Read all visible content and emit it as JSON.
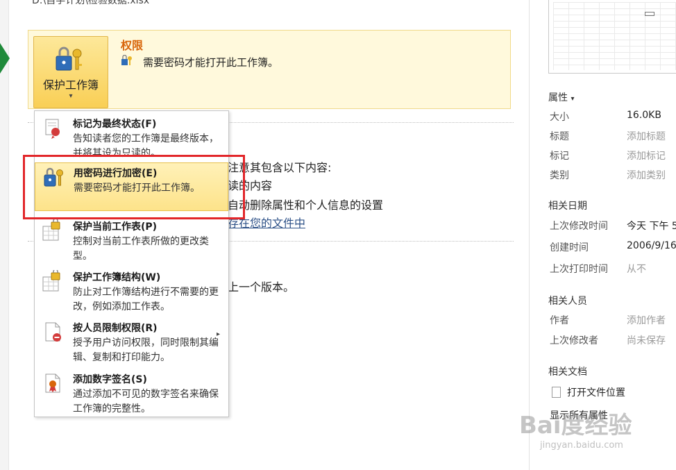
{
  "file_path": "D:\\自学计划\\检验数据.xlsx",
  "permissions": {
    "button_label": "保护工作簿",
    "caret": "▾",
    "title": "权限",
    "description": "需要密码才能打开此工作簿。"
  },
  "background_text": {
    "line1": "注意其包含以下内容:",
    "line2": "读的内容",
    "line3": "自动删除属性和个人信息的设置",
    "line4_link": "存在您的文件中",
    "line5": "上一个版本。"
  },
  "menu": {
    "items": [
      {
        "title": "标记为最终状态(F)",
        "desc": "告知读者您的工作簿是最终版本，并将其设为只读的。"
      },
      {
        "title": "用密码进行加密(E)",
        "desc": "需要密码才能打开此工作簿。"
      },
      {
        "title": "保护当前工作表(P)",
        "desc": "控制对当前工作表所做的更改类型。"
      },
      {
        "title": "保护工作簿结构(W)",
        "desc": "防止对工作簿结构进行不需要的更改，例如添加工作表。"
      },
      {
        "title": "按人员限制权限(R)",
        "desc": "授予用户访问权限，同时限制其编辑、复制和打印能力。",
        "arrow": "▸"
      },
      {
        "title": "添加数字签名(S)",
        "desc": "通过添加不可见的数字签名来确保工作簿的完整性。"
      }
    ]
  },
  "right_panel": {
    "properties_header": "属性",
    "properties_caret": "▾",
    "properties": [
      {
        "label": "大小",
        "value": "16.0KB",
        "muted": false
      },
      {
        "label": "标题",
        "value": "添加标题",
        "muted": true
      },
      {
        "label": "标记",
        "value": "添加标记",
        "muted": true
      },
      {
        "label": "类别",
        "value": "添加类别",
        "muted": true
      }
    ],
    "dates_header": "相关日期",
    "dates": [
      {
        "label": "上次修改时间",
        "value": "今天 下午 5",
        "muted": false
      },
      {
        "label": "创建时间",
        "value": "2006/9/16",
        "muted": false
      },
      {
        "label": "上次打印时间",
        "value": "从不",
        "muted": true
      }
    ],
    "people_header": "相关人员",
    "people": [
      {
        "label": "作者",
        "value": "添加作者",
        "muted": true
      },
      {
        "label": "上次修改者",
        "value": "尚未保存",
        "muted": true
      }
    ],
    "docs_header": "相关文档",
    "open_location": "打开文件位置",
    "show_all": "显示所有属性"
  },
  "watermark": {
    "main": "Bai度经验",
    "sub": "jingyan.baidu.com"
  },
  "colors": {
    "accent": "#d8650a",
    "highlight": "#fde38a",
    "red_box": "#e2262a"
  }
}
